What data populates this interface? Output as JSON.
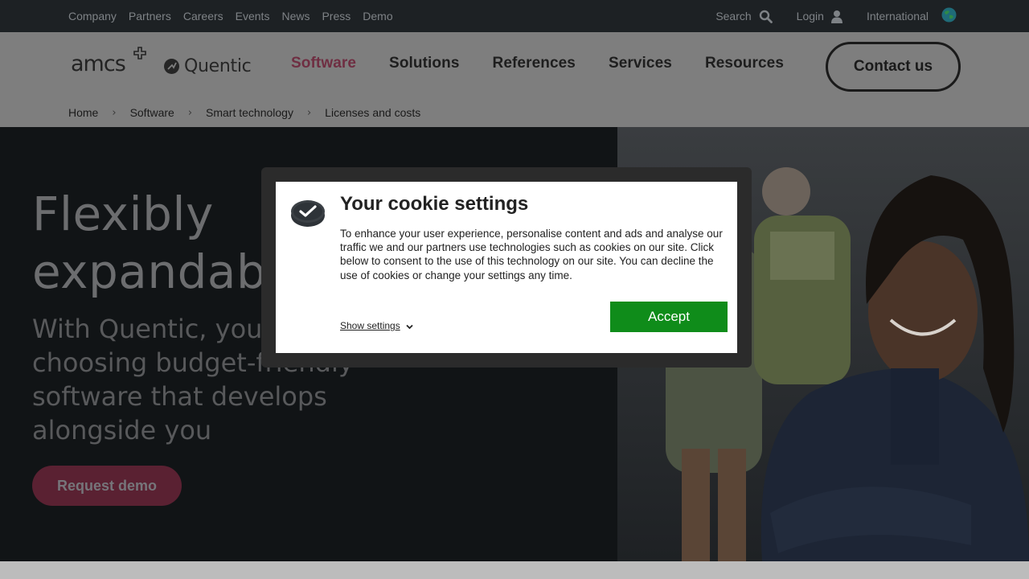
{
  "utility_nav": {
    "links": [
      "Company",
      "Partners",
      "Careers",
      "Events",
      "News",
      "Press",
      "Demo"
    ],
    "search_label": "Search",
    "login_label": "Login",
    "region_label": "International",
    "search_icon": "search-icon",
    "login_icon": "user-icon",
    "region_icon": "globe-icon"
  },
  "logos": {
    "amcs": "amcs",
    "quentic": "Quentic"
  },
  "main_nav": {
    "items": [
      "Software",
      "Solutions",
      "References",
      "Services",
      "Resources"
    ],
    "active": "Software",
    "contact_label": "Contact us"
  },
  "breadcrumb": {
    "items": [
      "Home",
      "Software",
      "Smart technology",
      "Licenses and costs"
    ],
    "separator": "›"
  },
  "hero": {
    "title_line1": "Flexibly",
    "title_line2": "expandab",
    "subtitle_line1": "With Quentic, you",
    "subtitle_line2": "choosing budget-friendly",
    "subtitle_line3": "software that develops",
    "subtitle_line4": "alongside you",
    "cta_label": "Request demo"
  },
  "cookie_modal": {
    "title": "Your cookie settings",
    "body": "To enhance your user experience, personalise content and ads and analyse our traffic we and our partners use technologies such as cookies on our site. Click below to consent to the use of this technology on our site. You can decline the use of cookies or change your settings any time.",
    "show_settings_label": "Show settings",
    "accept_label": "Accept",
    "icon": "cookie-icon"
  },
  "colors": {
    "accent": "#c0395f",
    "accept_green": "#0f8c1a",
    "topbar_bg": "#1d2124"
  }
}
